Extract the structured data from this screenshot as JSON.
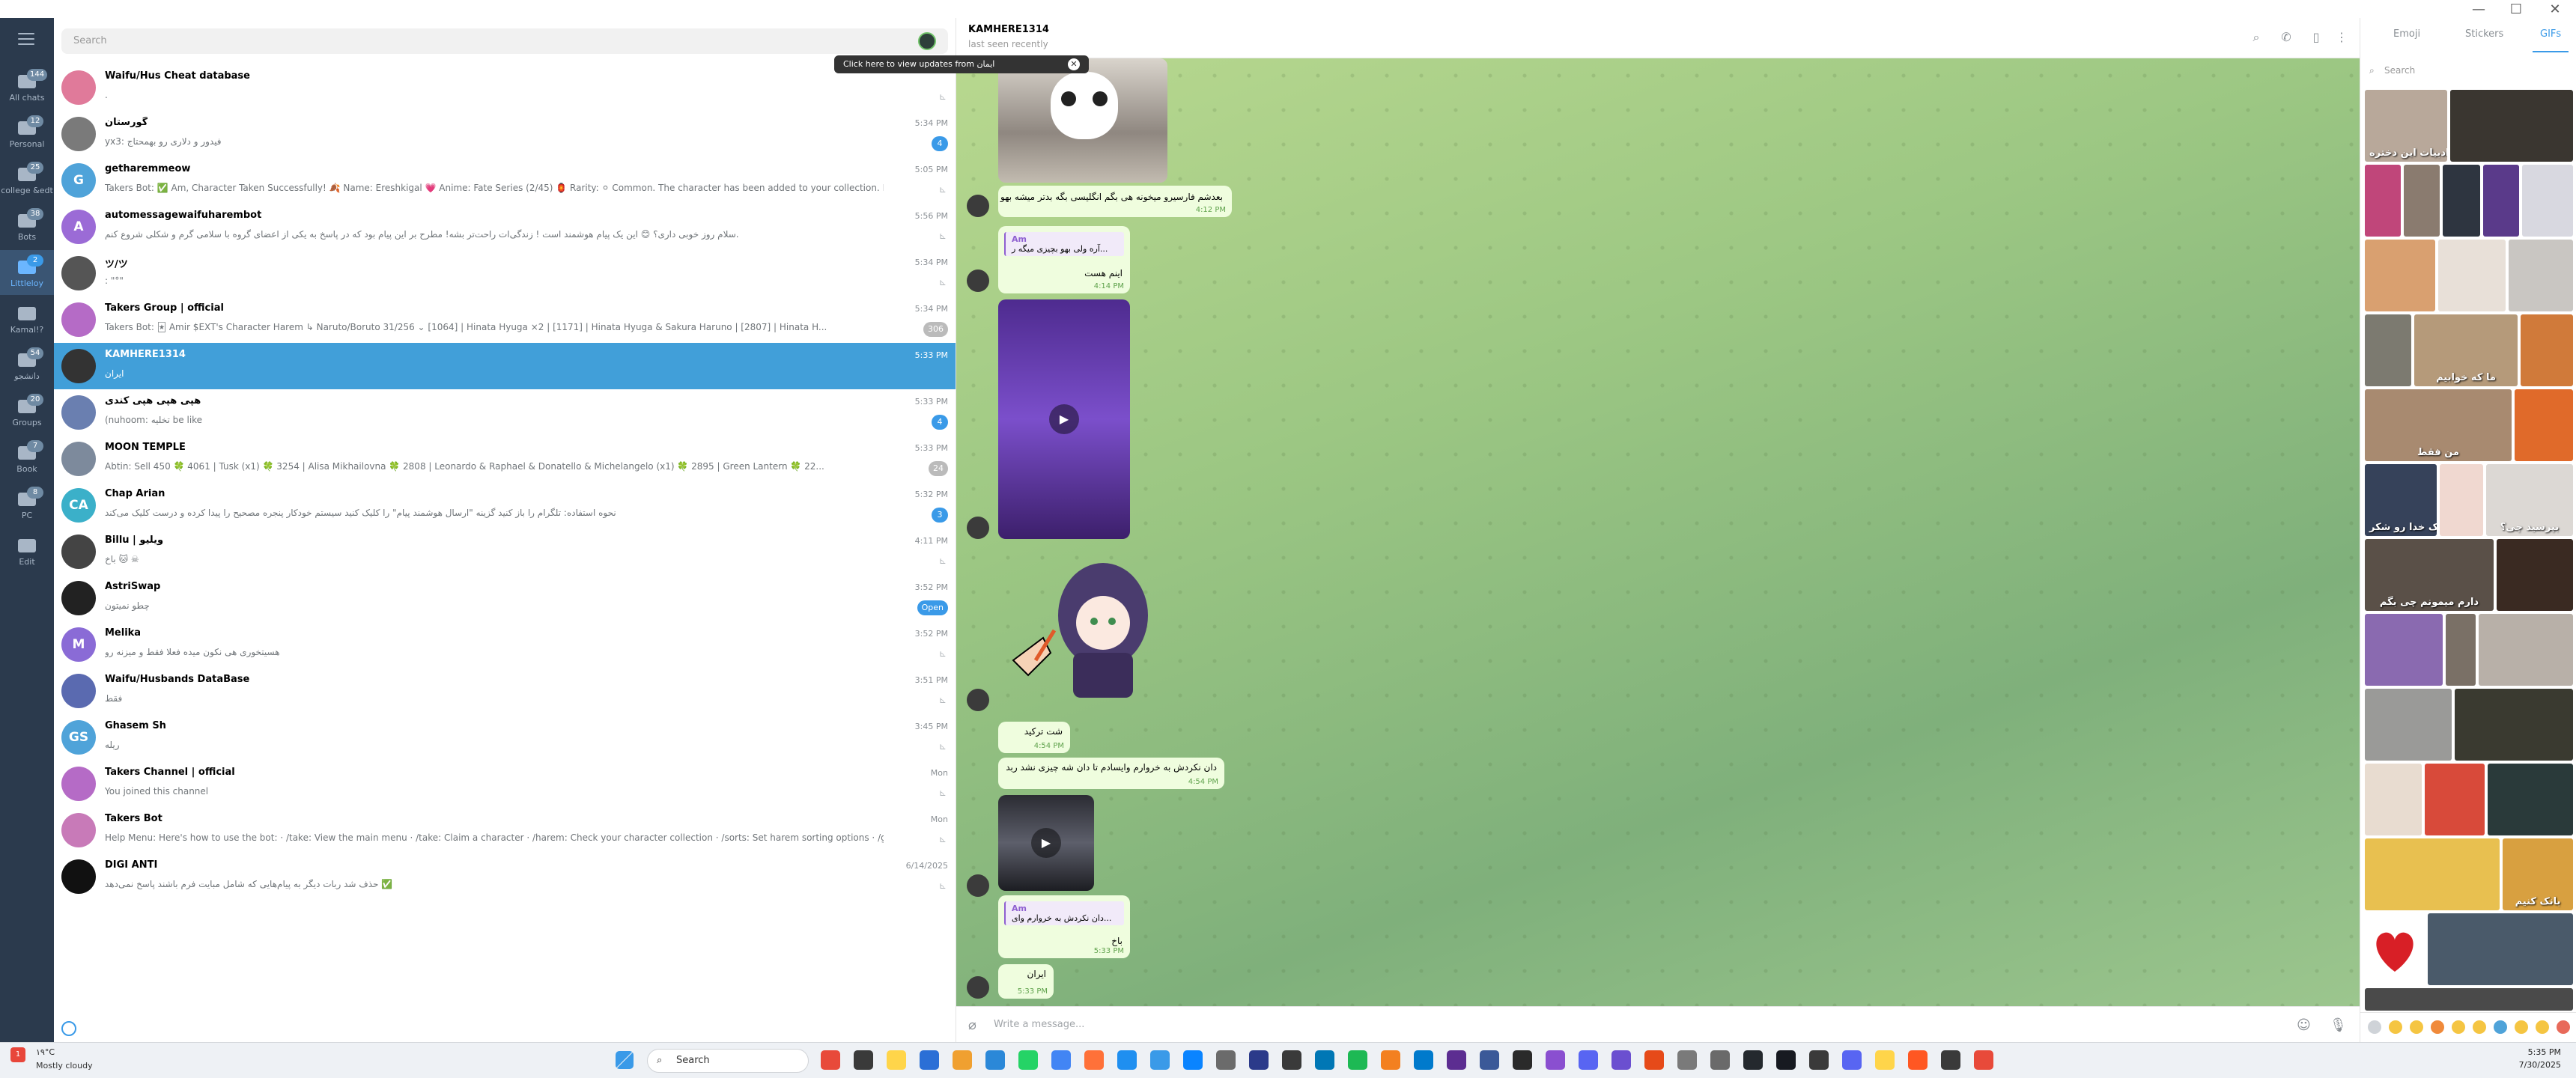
{
  "window": {
    "minimize": "—",
    "maximize": "☐",
    "close": "✕"
  },
  "folders": [
    {
      "label": "All chats",
      "badge": "144"
    },
    {
      "label": "Personal",
      "badge": "12"
    },
    {
      "label": "college &edt",
      "badge": "25"
    },
    {
      "label": "Bots",
      "badge": "38"
    },
    {
      "label": "Littleloy",
      "badge": "2",
      "active": true
    },
    {
      "label": "Kamal!?",
      "badge": ""
    },
    {
      "label": "دانشجو",
      "badge": "54"
    },
    {
      "label": "Groups",
      "badge": "20"
    },
    {
      "label": "Book",
      "badge": "7"
    },
    {
      "label": "PC",
      "badge": "8"
    },
    {
      "label": "Edit",
      "badge": ""
    }
  ],
  "search": {
    "placeholder": "Search"
  },
  "tooltip": {
    "text": "Click here to view updates from ایمان",
    "close": "✕"
  },
  "chats": [
    {
      "name": "Waifu/Hus Cheat database",
      "preview": ".",
      "time": "",
      "badge": "",
      "color": "#e07a9a",
      "initials": ""
    },
    {
      "name": "گورستان",
      "preview": "yx3: فیدور و دلاری رو بهمحتاج",
      "time": "5:34 PM",
      "badge": "4",
      "color": "#7a7a7a",
      "initials": ""
    },
    {
      "name": "getharemmeow",
      "preview": "Takers Bot: ✅ Am, Character Taken Successfully! 🍂 Name: Ereshkigal 💗 Anime: Fate Series (2/45) 🏮 Rarity: ⚪ Common. The character has been added to your collection. Daily capture...",
      "time": "5:05 PM",
      "badge": "",
      "color": "#4fa3d9",
      "initials": "G"
    },
    {
      "name": "automessagewaifuharembot",
      "preview": "سلام روز خوبی داری؟ 😊 این یک پیام هوشمند است ! زندگی‌ات راحت‌تر بشه! مطرح بر این پیام بود که در پاسخ به یکی از اعضای گروه با سلامی گرم و شکلی شروع کنم.",
      "time": "5:56 PM",
      "badge": "",
      "color": "#9b6bd6",
      "initials": "A"
    },
    {
      "name": "ツ/ツ",
      "preview": ": \"°\"",
      "time": "5:34 PM",
      "badge": "",
      "color": "#555",
      "initials": ""
    },
    {
      "name": "Takers Group | official",
      "preview": "Takers Bot: 🃏 Amir $EXT's Character Harem ↳ Naruto/Boruto 31/256 ⌄ [1064] | Hinata Hyuga ×2 | [1171] | Hinata Hyuga & Sakura Haruno | [2807] | Hinata H...",
      "time": "5:34 PM",
      "badge": "306",
      "color": "#b56bc6",
      "initials": ""
    },
    {
      "name": "KAMHERE1314",
      "preview": "ایران",
      "time": "5:33 PM",
      "badge": "",
      "color": "#333",
      "initials": "",
      "selected": true
    },
    {
      "name": "هپی هپی هپی کندی",
      "preview": "(nuhoom: تخلیه be like",
      "time": "5:33 PM",
      "badge": "4",
      "color": "#6a7fb0",
      "initials": ""
    },
    {
      "name": "MOON TEMPLE",
      "preview": "Abtin: Sell 450 🍀 4061 | Tusk (x1) 🍀 3254 | Alisa Mikhailovna 🍀 2808 | Leonardo & Raphael & Donatello & Michelangelo (x1) 🍀 2895 | Green Lantern 🍀 22...",
      "time": "5:33 PM",
      "badge": "24",
      "color": "#7d8a9c",
      "initials": ""
    },
    {
      "name": "Chap Arian",
      "preview": "نحوه استفاده: تلگرام را باز کنید گزینه \"ارسال هوشمند پیام\" را کلیک کنید سیستم خودکار پنجره مصحیح را پیدا کرده و درست کلیک می‌کند",
      "time": "5:32 PM",
      "badge": "3",
      "color": "#3bb0c9",
      "initials": "CA"
    },
    {
      "name": "Billu | ویلیو",
      "preview": "باخ 🐱 ☠",
      "time": "4:11 PM",
      "badge": "",
      "color": "#444",
      "initials": ""
    },
    {
      "name": "AstriSwap",
      "preview": "چطو نمیتون",
      "time": "3:52 PM",
      "badge": "Open",
      "color": "#222",
      "initials": ""
    },
    {
      "name": "Melika",
      "preview": "هسیتخوری هی نکون میده فعلا فقط و میزنه رو",
      "time": "3:52 PM",
      "badge": "",
      "color": "#8a6bd6",
      "initials": "M"
    },
    {
      "name": "Waifu/Husbands DataBase",
      "preview": "فقط",
      "time": "3:51 PM",
      "badge": "",
      "color": "#5a6ab0",
      "initials": ""
    },
    {
      "name": "Ghasem Sh",
      "preview": "ریله",
      "time": "3:45 PM",
      "badge": "",
      "color": "#4fa3d9",
      "initials": "GS"
    },
    {
      "name": "Takers Channel | official",
      "preview": "You joined this channel",
      "time": "Mon",
      "badge": "",
      "color": "#b56bc6",
      "initials": ""
    },
    {
      "name": "Takers Bot",
      "preview": "Help Menu: Here's how to use the bot: · /take: View the main menu · /take: Claim a character · /harem: Check your character collection · /sorts: Set harem sorting options · /gift: Gift a character to som...",
      "time": "Mon",
      "badge": "",
      "color": "#c87ab8",
      "initials": ""
    },
    {
      "name": "DIGI ANTI",
      "preview": "حذف شد ربات دیگر به پیام‌هایی که شامل مبایت فرم باشند پاسخ نمی‌دهد ✅",
      "time": "6/14/2025",
      "badge": "",
      "color": "#111",
      "initials": ""
    }
  ],
  "chat": {
    "name": "KAMHERE1314",
    "status": "last seen recently",
    "messages": [
      {
        "text": "بعدشم فارسیرو میخونه هی بگم انگلیسی بگه بدتر میشه بهو",
        "time": "4:12 PM"
      },
      {
        "reply_name": "Am",
        "reply_text": "آره ولی بهو بچیزی میگه ر...",
        "text": "اینم هست",
        "time": "4:14 PM"
      },
      {
        "text": "شت ترکید",
        "time": "4:54 PM"
      },
      {
        "text": "دان نکردش به خروارم وایسادم تا دان شه چیزی نشد ربد",
        "time": "4:54 PM"
      },
      {
        "reply_name": "Am",
        "reply_text": "دان نکردش به خروارم وای...",
        "text": "باخ",
        "time": "5:33 PM"
      },
      {
        "text": "ایران",
        "time": "5:33 PM"
      }
    ],
    "compose_placeholder": "Write a message..."
  },
  "panel": {
    "tabs": [
      "Emoji",
      "Stickers",
      "GIFs"
    ],
    "search_placeholder": "Search",
    "gif_captions": [
      "ادبیات این دختره",
      "ما که خوابیم",
      "من فقط",
      "بوک خدا رو شکر",
      "بپرسید چی؟",
      "دارم میمونم چی بگم",
      "بانک کنیم"
    ]
  },
  "taskbar": {
    "temp": "۱۹°C",
    "weather_badge": "1",
    "condition": "Mostly cloudy",
    "search": "Search",
    "time": "5:35 PM",
    "date": "7/30/2025"
  }
}
